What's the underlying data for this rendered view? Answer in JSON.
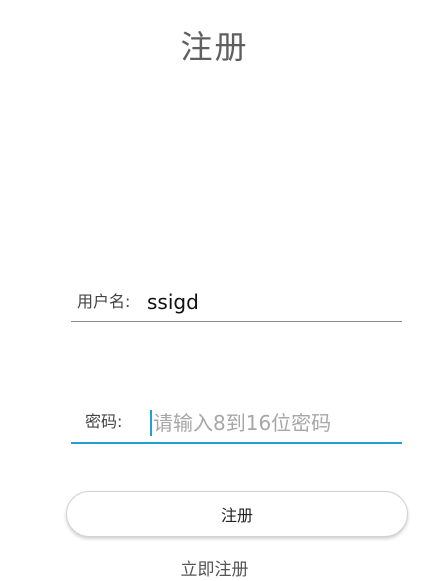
{
  "page": {
    "title": "注册"
  },
  "form": {
    "username": {
      "label": "用户名:",
      "value": "ssigd"
    },
    "password": {
      "label": "密码:",
      "value": "",
      "placeholder": "请输入8到16位密码"
    }
  },
  "actions": {
    "register_button_label": "注册",
    "register_link_label": "立即注册"
  },
  "colors": {
    "focus_accent": "#1f9fd4",
    "title_gray": "#5f5f5f"
  }
}
